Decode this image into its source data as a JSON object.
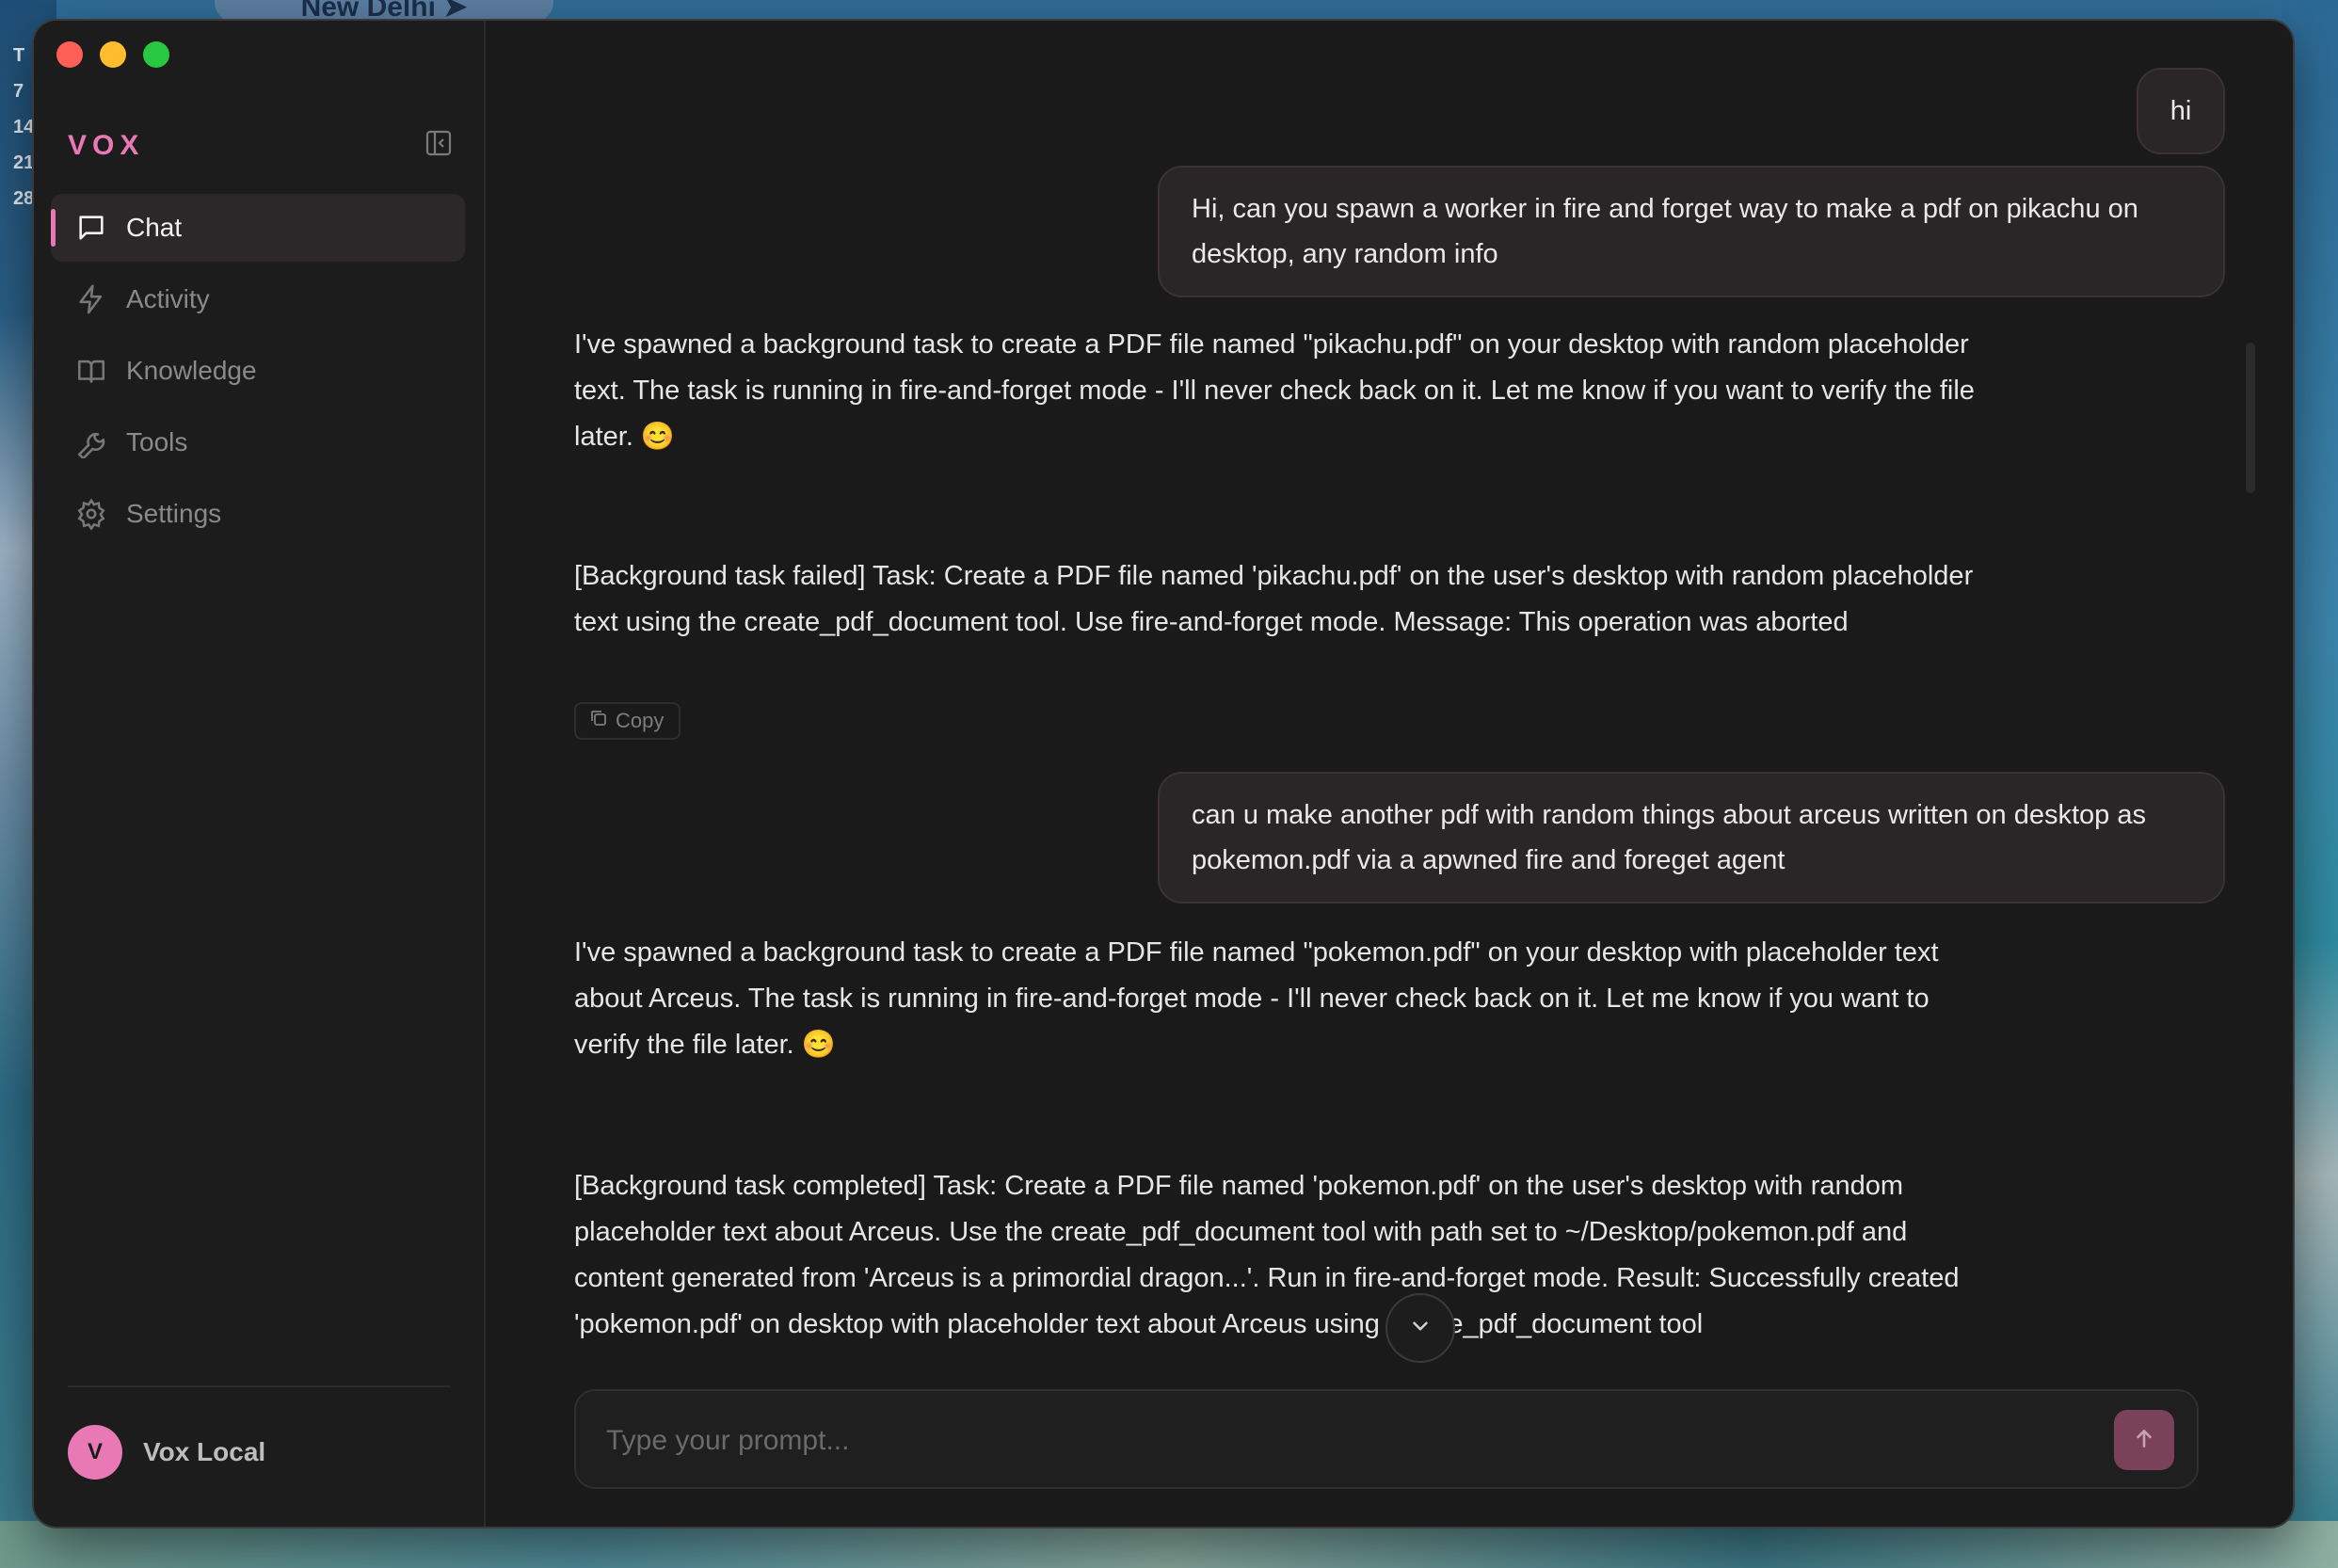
{
  "desktop": {
    "weather_label": "New Delhi",
    "calendar_numbers": [
      "T",
      "7",
      "14",
      "21",
      "28"
    ]
  },
  "app": {
    "brand": "VOX"
  },
  "sidebar": {
    "items": [
      {
        "label": "Chat",
        "icon": "chat-icon",
        "active": true
      },
      {
        "label": "Activity",
        "icon": "lightning-icon",
        "active": false
      },
      {
        "label": "Knowledge",
        "icon": "book-icon",
        "active": false
      },
      {
        "label": "Tools",
        "icon": "wrench-icon",
        "active": false
      },
      {
        "label": "Settings",
        "icon": "gear-icon",
        "active": false
      }
    ],
    "user": {
      "initial": "V",
      "name": "Vox Local"
    }
  },
  "chat": {
    "messages": [
      {
        "role": "user",
        "text": "hi"
      },
      {
        "role": "user",
        "text": "Hi, can you spawn a worker in fire and forget way to make a pdf on pikachu on desktop, any random info"
      },
      {
        "role": "assistant",
        "text": "I've spawned a background task to create a PDF file named \"pikachu.pdf\" on your desktop with random placeholder text. The task is running in fire-and-forget mode - I'll never check back on it. Let me know if you want to verify the file later. 😊"
      },
      {
        "role": "assistant",
        "text": "[Background task failed] Task: Create a PDF file named 'pikachu.pdf' on the user's desktop with random placeholder text using the create_pdf_document tool. Use fire-and-forget mode. Message: This operation was aborted"
      },
      {
        "role": "user",
        "text": "can u make another pdf with random things about arceus written on desktop as pokemon.pdf via a apwned fire and foreget agent"
      },
      {
        "role": "assistant",
        "text": "I've spawned a background task to create a PDF file named \"pokemon.pdf\" on your desktop with placeholder text about Arceus. The task is running in fire-and-forget mode - I'll never check back on it. Let me know if you want to verify the file later. 😊"
      },
      {
        "role": "assistant",
        "text": "[Background task completed] Task: Create a PDF file named 'pokemon.pdf' on the user's desktop with random placeholder text about Arceus. Use the create_pdf_document tool with path set to ~/Desktop/pokemon.pdf and content generated from 'Arceus is a primordial dragon...'. Run in fire-and-forget mode. Result: Successfully created 'pokemon.pdf' on desktop with placeholder text about Arceus using create_pdf_document tool"
      }
    ],
    "copy_label": "Copy"
  },
  "composer": {
    "placeholder": "Type your prompt..."
  },
  "colors": {
    "accent": "#e879b4",
    "send_button": "#7a4259"
  }
}
